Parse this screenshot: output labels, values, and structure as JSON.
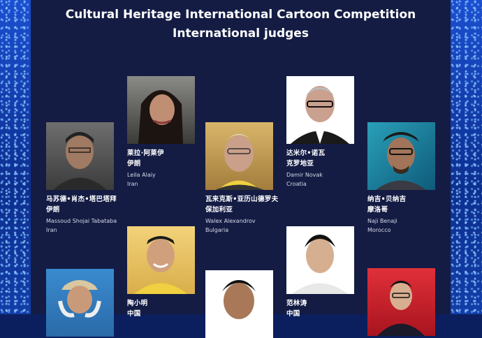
{
  "title_line1": "Cultural Heritage International Cartoon Competition",
  "title_line2": "International judges",
  "judges": [
    {
      "name_cn_1": "马苏德•肖杰•塔巴塔拜",
      "name_cn_2": "伊朗",
      "name_en": "Massoud Shojai Tabataba",
      "country_en": "Iran"
    },
    {
      "name_cn_1": "莱拉·阿莱伊",
      "name_cn_2": "伊朗",
      "name_en": "Leila Alaiy",
      "country_en": "Iran"
    },
    {
      "name_cn_1": "瓦来克斯•亚历山德罗夫",
      "name_cn_2": "保加利亚",
      "name_en": "Walex Alexandrov",
      "country_en": "Bulgaria"
    },
    {
      "name_cn_1": "达米尔•诺瓦",
      "name_cn_2": "克罗地亚",
      "name_en": "Damir Novak",
      "country_en": "Croatia"
    },
    {
      "name_cn_1": "纳吉•贝纳吉",
      "name_cn_2": "摩洛哥",
      "name_en": "Naji Benaji",
      "country_en": "Morocco"
    },
    {
      "name_cn_1": "陶小明",
      "name_cn_2": "中国"
    },
    {
      "name_cn_1": "范林涛",
      "name_cn_2": "中国"
    },
    {},
    {},
    {}
  ]
}
